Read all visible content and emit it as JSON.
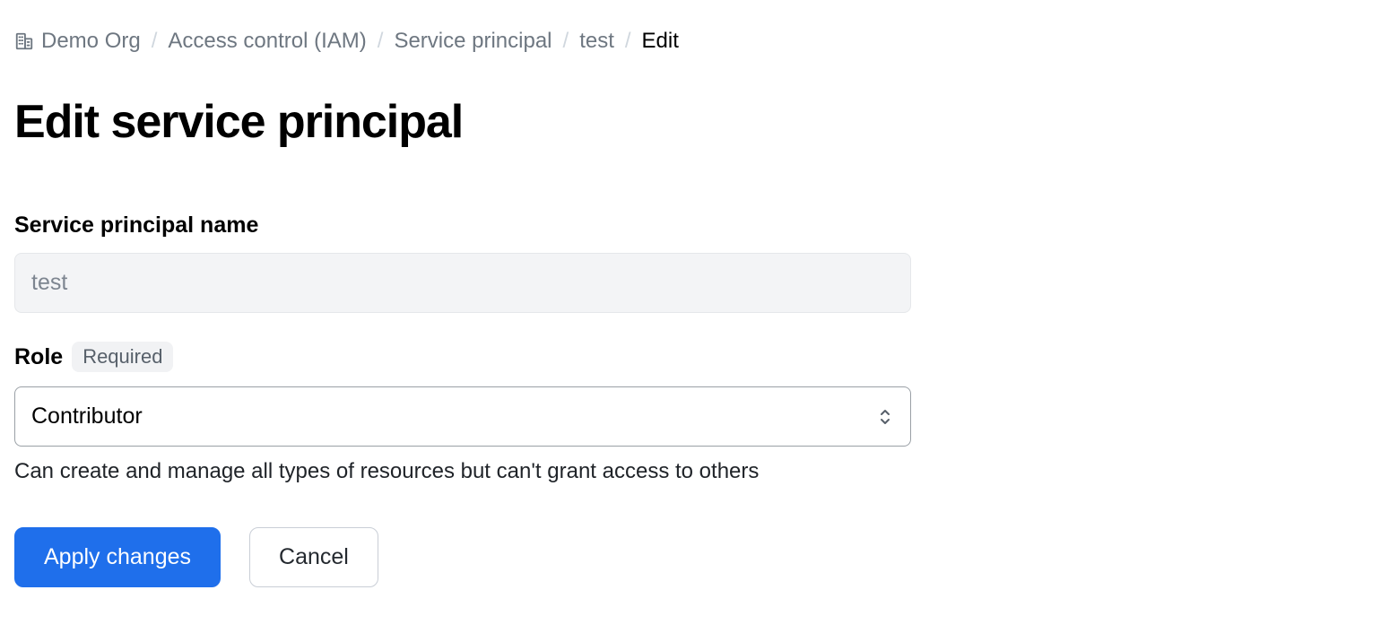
{
  "breadcrumb": {
    "items": [
      {
        "label": "Demo Org",
        "has_icon": true
      },
      {
        "label": "Access control (IAM)"
      },
      {
        "label": "Service principal"
      },
      {
        "label": "test"
      }
    ],
    "current": "Edit"
  },
  "page": {
    "title": "Edit service principal"
  },
  "form": {
    "name": {
      "label": "Service principal name",
      "value": "test"
    },
    "role": {
      "label": "Role",
      "required_badge": "Required",
      "selected": "Contributor",
      "help_text": "Can create and manage all types of resources but can't grant access to others"
    },
    "actions": {
      "apply": "Apply changes",
      "cancel": "Cancel"
    }
  }
}
